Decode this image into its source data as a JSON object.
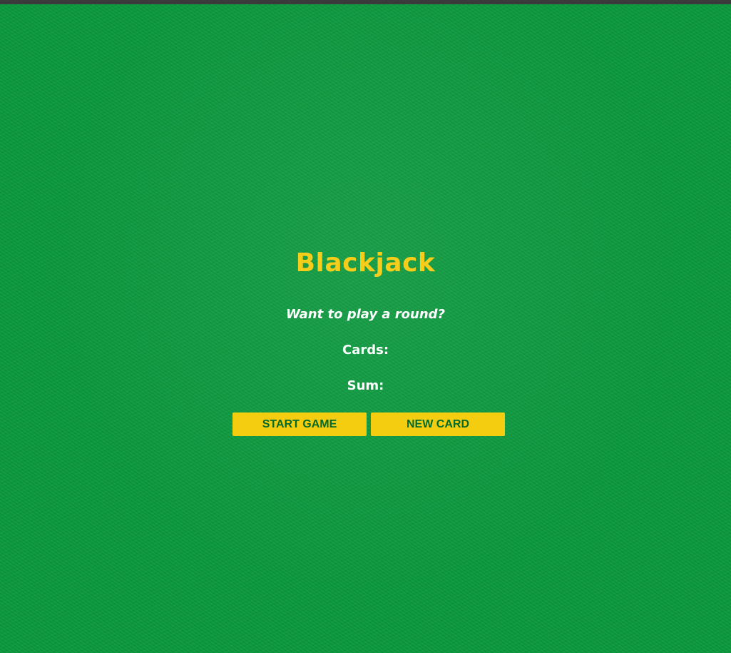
{
  "game": {
    "title": "Blackjack",
    "message": "Want to play a round?",
    "cards_label": "Cards:",
    "cards_value": "",
    "sum_label": "Sum:",
    "sum_value": ""
  },
  "controls": {
    "start_label": "START GAME",
    "new_card_label": "NEW CARD"
  },
  "colors": {
    "felt": "#0b9b3e",
    "title": "#f5cd1a",
    "button_bg": "#f5cd10",
    "button_text": "#036b2a",
    "text": "#ffffff"
  }
}
